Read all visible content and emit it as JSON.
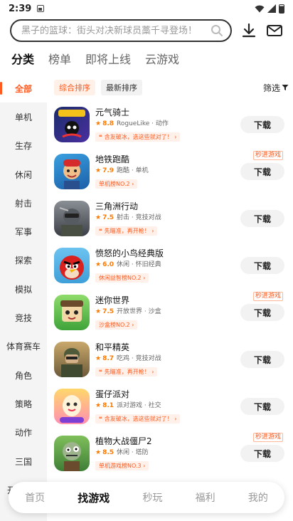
{
  "status": {
    "time": "2:39"
  },
  "search": {
    "placeholder": "黑子的篮球：街头对决新球员藁千寻登场！"
  },
  "top_tabs": [
    {
      "label": "分类",
      "active": true
    },
    {
      "label": "榜单",
      "active": false
    },
    {
      "label": "即将上线",
      "active": false
    },
    {
      "label": "云游戏",
      "active": false
    }
  ],
  "sidebar": [
    {
      "label": "全部",
      "active": true
    },
    {
      "label": "单机"
    },
    {
      "label": "生存"
    },
    {
      "label": "休闲"
    },
    {
      "label": "射击"
    },
    {
      "label": "军事"
    },
    {
      "label": "探索"
    },
    {
      "label": "模拟"
    },
    {
      "label": "竞技"
    },
    {
      "label": "体育赛车"
    },
    {
      "label": "角色"
    },
    {
      "label": "策略"
    },
    {
      "label": "动作"
    },
    {
      "label": "三国"
    },
    {
      "label": "开放世界"
    }
  ],
  "filters": {
    "sort_default": "综合排序",
    "sort_latest": "最新排序",
    "filter_label": "筛选"
  },
  "games": [
    {
      "name": "元气骑士",
      "rating": "8.8",
      "genres": "RogueLike · 动作",
      "tag": "含友破冰，选这些就对了！",
      "tag_prefix": "❝",
      "badge": "",
      "download": "下载"
    },
    {
      "name": "地铁跑酷",
      "rating": "7.9",
      "genres": "跑酷 · 单机",
      "tag": "单机榜NO.2",
      "tag_prefix": "",
      "badge": "秒进游戏",
      "download": "下载"
    },
    {
      "name": "三角洲行动",
      "rating": "7.5",
      "genres": "射击 · 竞技对战",
      "tag": "先瞄准，再开枪！",
      "tag_prefix": "❝",
      "badge": "",
      "download": "下载"
    },
    {
      "name": "愤怒的小鸟经典版",
      "rating": "6.0",
      "genres": "休闲 · 怀旧经典",
      "tag": "休闲益智榜NO.2",
      "tag_prefix": "",
      "badge": "",
      "download": "下载"
    },
    {
      "name": "迷你世界",
      "rating": "7.5",
      "genres": "开放世界 · 沙盒",
      "tag": "沙盒榜NO.2",
      "tag_prefix": "",
      "badge": "秒进游戏",
      "download": "下载"
    },
    {
      "name": "和平精英",
      "rating": "8.7",
      "genres": "吃鸡 · 竞技对战",
      "tag": "先瞄准，再开枪！",
      "tag_prefix": "❝",
      "badge": "",
      "download": "下载"
    },
    {
      "name": "蛋仔派对",
      "rating": "8.1",
      "genres": "派对游戏 · 社交",
      "tag": "含友破冰，选这些就对了！",
      "tag_prefix": "❝",
      "badge": "",
      "download": "下载"
    },
    {
      "name": "植物大战僵尸2",
      "rating": "8.5",
      "genres": "休闲 · 塔防",
      "tag": "单机游戏榜NO.3",
      "tag_prefix": "",
      "badge": "秒进游戏",
      "download": "下载"
    }
  ],
  "bottom_nav": [
    {
      "label": "首页",
      "active": false
    },
    {
      "label": "找游戏",
      "active": true
    },
    {
      "label": "秒玩",
      "active": false
    },
    {
      "label": "福利",
      "active": false
    },
    {
      "label": "我的",
      "active": false
    }
  ],
  "colors": {
    "accent": "#ff5a1f",
    "rating": "#ff7a00"
  }
}
